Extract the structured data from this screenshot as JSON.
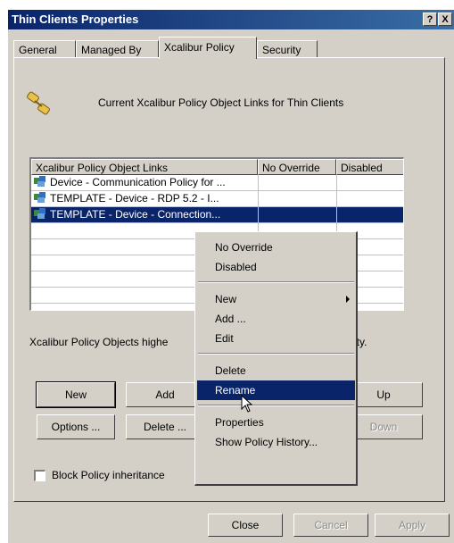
{
  "window": {
    "title": "Thin Clients Properties",
    "help_btn": "?",
    "close_btn": "X"
  },
  "tabs": [
    "General",
    "Managed By",
    "Xcalibur Policy",
    "Security"
  ],
  "active_tab": "Xcalibur Policy",
  "header": {
    "icon": "policy-link-icon",
    "text": "Current Xcalibur Policy Object Links for Thin Clients"
  },
  "list": {
    "columns": [
      "Xcalibur Policy Object Links",
      "No Override",
      "Disabled"
    ],
    "rows": [
      {
        "name": "Device - Communication Policy for ...",
        "icon": "policy-object-icon",
        "selected": false
      },
      {
        "name": "TEMPLATE - Device - RDP 5.2 - I...",
        "icon": "policy-object-icon",
        "selected": false
      },
      {
        "name": "TEMPLATE - Device - Connection...",
        "icon": "policy-object-icon",
        "selected": true
      }
    ]
  },
  "info_text": "Xcalibur Policy Objects highe",
  "info_text_end": "rity.",
  "buttons": {
    "new": "New",
    "add": "Add",
    "up": "Up",
    "options": "Options ...",
    "delete": "Delete ...",
    "down": "Down"
  },
  "checkbox": {
    "label": "Block Policy inheritance",
    "checked": false
  },
  "footer": {
    "close": "Close",
    "cancel": "Cancel",
    "apply": "Apply"
  },
  "context_menu": {
    "items": {
      "no_override": "No Override",
      "disabled": "Disabled",
      "new": "New",
      "add": "Add ...",
      "edit": "Edit",
      "delete": "Delete",
      "rename": "Rename",
      "properties": "Properties",
      "history": "Show Policy History..."
    },
    "highlighted": "Rename"
  },
  "colors": {
    "titlebar": "#0a246a",
    "selection": "#0a246a",
    "face": "#d4d0c8"
  }
}
